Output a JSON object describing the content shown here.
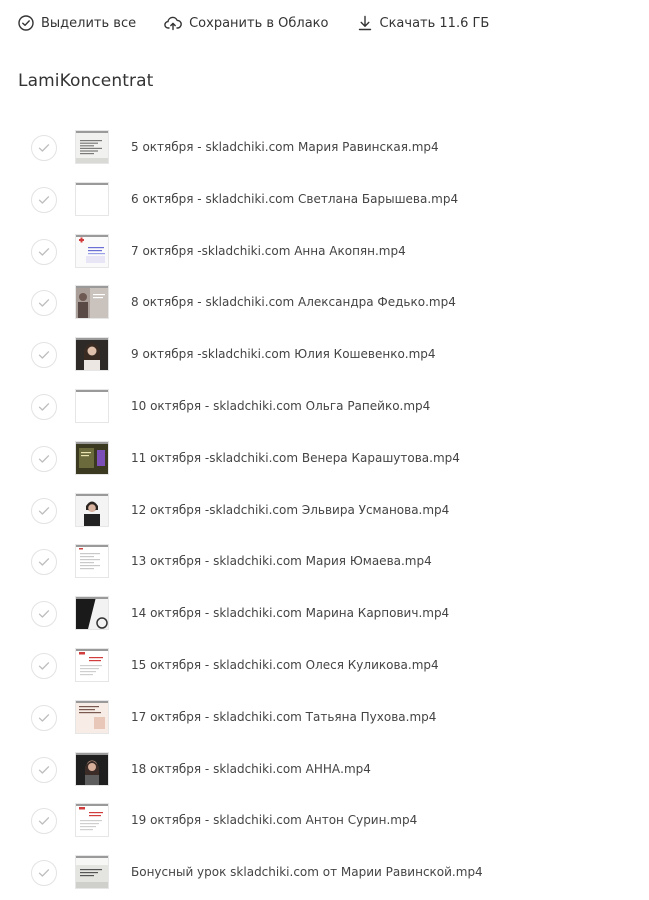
{
  "toolbar": {
    "select_all": "Выделить все",
    "save_to_cloud": "Сохранить в Облако",
    "download": "Скачать 11.6 ГБ"
  },
  "folder": {
    "title": "LamiKoncentrat"
  },
  "files": [
    {
      "name": "5 октября - skladchiki.com Мария Равинская.mp4",
      "thumb": "slide-text"
    },
    {
      "name": "6 октября - skladchiki.com Светлана Барышева.mp4",
      "thumb": "blank"
    },
    {
      "name": "7 октября -skladchiki.com Анна Акопян.mp4",
      "thumb": "slide-logo"
    },
    {
      "name": "8 октября - skladchiki.com Александра Федько.mp4",
      "thumb": "slide-portrait"
    },
    {
      "name": "9 октября -skladchiki.com Юлия Кошевенко.mp4",
      "thumb": "portrait"
    },
    {
      "name": "10 октября - skladchiki.com Ольга Рапейко.mp4",
      "thumb": "blank"
    },
    {
      "name": "11 октября -skladchiki.com Венера Карашутова.mp4",
      "thumb": "dark-slide"
    },
    {
      "name": "12 октября -skladchiki.com Эльвира Усманова.mp4",
      "thumb": "webcam"
    },
    {
      "name": "13 октября - skladchiki.com Мария Юмаева.mp4",
      "thumb": "doc"
    },
    {
      "name": "14 октября - skladchiki.com Марина Карпович.mp4",
      "thumb": "bw-slide"
    },
    {
      "name": "15 октября - skladchiki.com Олеся Куликова.mp4",
      "thumb": "doc-red"
    },
    {
      "name": "17 октября - skladchiki.com Татьяна Пухова.mp4",
      "thumb": "slide-pink"
    },
    {
      "name": "18 октября - skladchiki.com АННА.mp4",
      "thumb": "webcam-dark"
    },
    {
      "name": "19 октября - skladchiki.com Антон Сурин.mp4",
      "thumb": "doc-red"
    },
    {
      "name": "Бонусный урок skladchiki.com от Марии Равинской.mp4",
      "thumb": "slide-grey"
    }
  ],
  "colors": {
    "text": "#333333",
    "check_border": "#e3e3e3",
    "check_mark": "#bdbdbd"
  }
}
